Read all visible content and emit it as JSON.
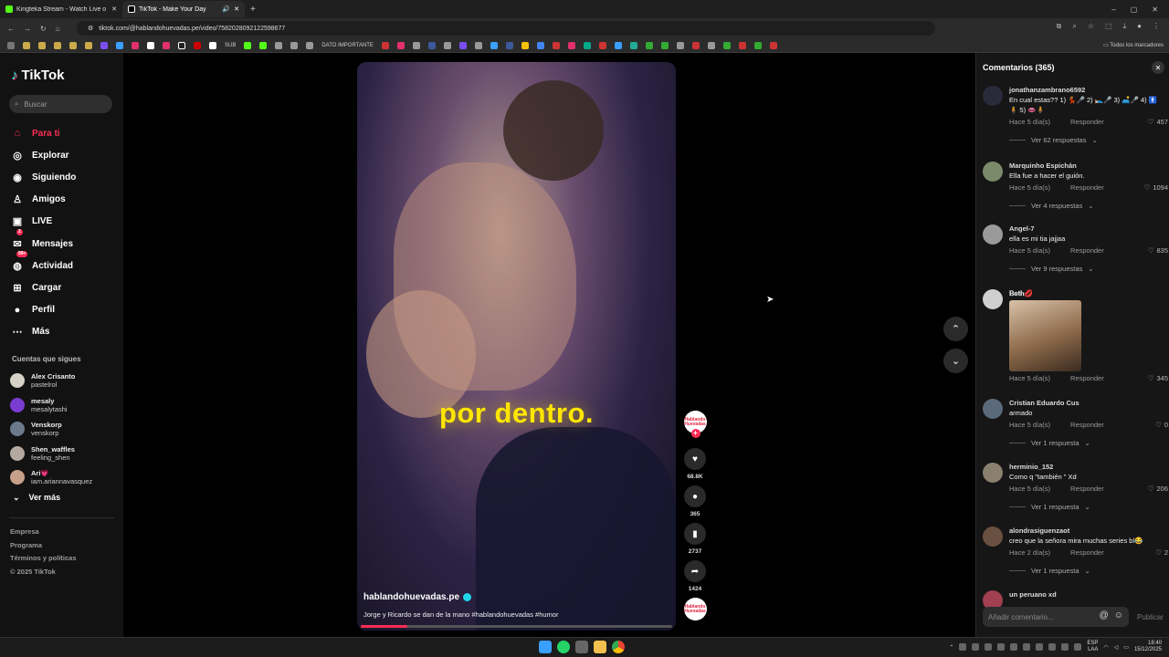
{
  "browser": {
    "tabs": [
      {
        "title": "Kingteka Stream - Watch Live o",
        "color": "#53fc18",
        "active": false
      },
      {
        "title": "TikTok - Make Your Day",
        "color": "#ffffff",
        "active": true
      }
    ],
    "url": "tiktok.com/@hablandohuevadas.pe/video/7582028092122598677",
    "bookmarks": [
      "SUB",
      "DATO IMPORTANTE"
    ],
    "all_bookmarks_label": "Todos los marcadores"
  },
  "sidebar": {
    "logo": "TikTok",
    "search_placeholder": "Buscar",
    "nav": [
      {
        "label": "Para ti",
        "icon": "home-icon",
        "glyph": "⌂"
      },
      {
        "label": "Explorar",
        "icon": "compass-icon",
        "glyph": "◎"
      },
      {
        "label": "Siguiendo",
        "icon": "following-icon",
        "glyph": "◉"
      },
      {
        "label": "Amigos",
        "icon": "friends-icon",
        "glyph": "♙"
      },
      {
        "label": "LIVE",
        "icon": "live-icon",
        "glyph": "▣"
      },
      {
        "label": "Mensajes",
        "icon": "messages-icon",
        "glyph": "✉",
        "badge": "2"
      },
      {
        "label": "Actividad",
        "icon": "activity-icon",
        "glyph": "◍",
        "badge": "99+"
      },
      {
        "label": "Cargar",
        "icon": "upload-icon",
        "glyph": "⊞"
      },
      {
        "label": "Perfil",
        "icon": "profile-icon",
        "glyph": "●"
      },
      {
        "label": "Más",
        "icon": "more-icon",
        "glyph": "⋯"
      }
    ],
    "following_title": "Cuentas que sigues",
    "following": [
      {
        "name": "Alex Crisanto",
        "handle": "pastelrol"
      },
      {
        "name": "mesaly",
        "handle": "mesalytashi"
      },
      {
        "name": "Venskorp",
        "handle": "venskorp"
      },
      {
        "name": "Shen_waffles",
        "handle": "feeling_shen"
      },
      {
        "name": "Ari💗",
        "handle": "iam.ariannavasquez"
      }
    ],
    "see_more": "Ver más",
    "footer": [
      "Empresa",
      "Programa",
      "Términos y políticas",
      "© 2025 TikTok"
    ]
  },
  "video": {
    "caption_overlay": "por dentro.",
    "username": "hablandohuevadas.pe",
    "description": "Jorge y Ricardo se dan de la mano #hablandohuevadas #humor",
    "progress": 0.15,
    "avatar_text": "Hablando Huevadas"
  },
  "actions": {
    "likes": "68.8K",
    "comments": "365",
    "saves": "2737",
    "shares": "1424"
  },
  "comments": {
    "header": "Comentarios (365)",
    "reply_label": "Responder",
    "items": [
      {
        "user": "jonathanzambrano6592",
        "text": "En cual estas?? 1) 💃🎤 2) 🛌🎤 3) 🛋️🎤 4) 🚹🧍 5) 👄🧍",
        "time": "Hace 5 día(s)",
        "likes": "457",
        "replies": "Ver 62 respuestas"
      },
      {
        "user": "Marquinho Espichán",
        "text": "Ella fue a hacer el guión.",
        "time": "Hace 5 día(s)",
        "likes": "1094",
        "replies": "Ver 4 respuestas"
      },
      {
        "user": "Angel-7",
        "text": "ella es mi tia jajjaa",
        "time": "Hace 5 día(s)",
        "likes": "835",
        "replies": "Ver 9 respuestas"
      },
      {
        "user": "𝐁𝐞𝐭𝐡💋",
        "text": "",
        "time": "Hace 5 día(s)",
        "likes": "345",
        "replies": ""
      },
      {
        "user": "Cristian Eduardo Cus",
        "text": "armado",
        "time": "Hace 5 día(s)",
        "likes": "0",
        "replies": "Ver 1 respuesta"
      },
      {
        "user": "herminio_152",
        "text": "Como q \"también \" Xd",
        "time": "Hace 5 día(s)",
        "likes": "206",
        "replies": "Ver 1 respuesta"
      },
      {
        "user": "alondrasiguenzaot",
        "text": "creo que la señora mira muchas series bl😂",
        "time": "Hace 2 día(s)",
        "likes": "2",
        "replies": "Ver 1 respuesta"
      },
      {
        "user": "un peruano xd",
        "text": "",
        "time": "",
        "likes": "",
        "replies": ""
      }
    ],
    "input_placeholder": "Añadir comentario...",
    "publish": "Publicar"
  },
  "taskbar": {
    "lang": "ESP",
    "lang2": "LAA",
    "time": "18:40",
    "date": "15/12/2025"
  }
}
